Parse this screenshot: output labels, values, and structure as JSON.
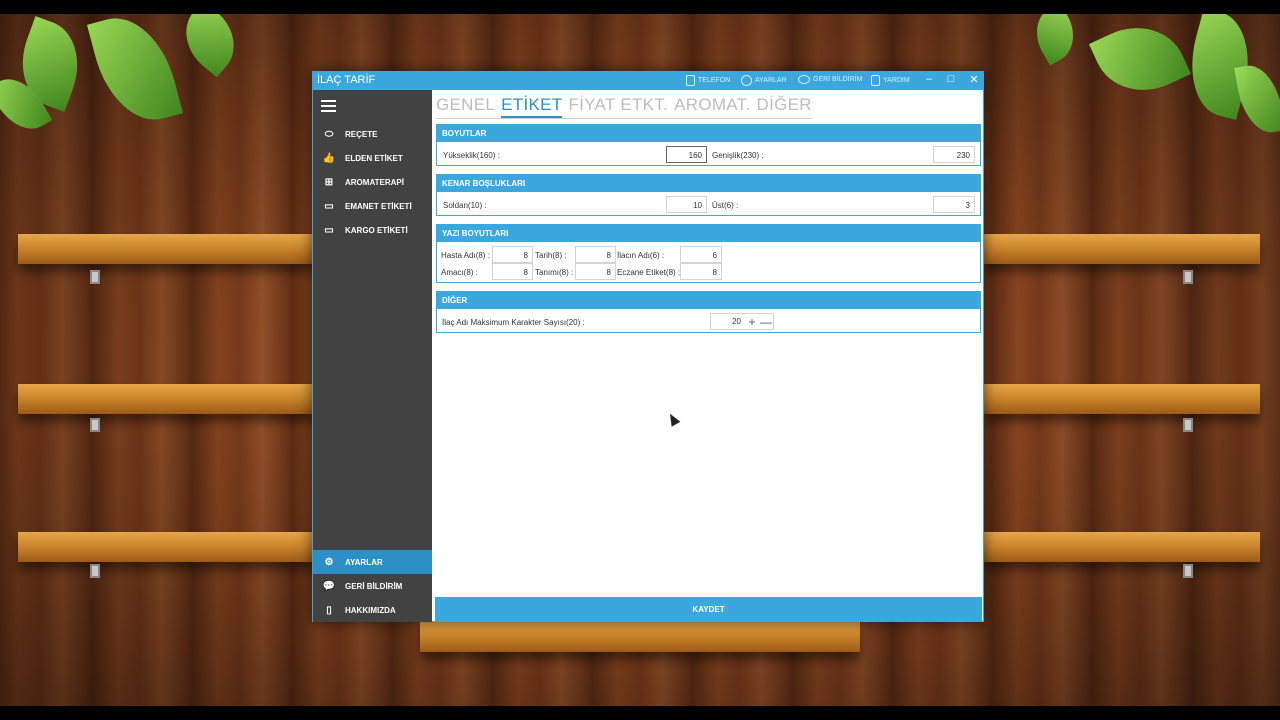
{
  "window": {
    "title": "İLAÇ TARİF",
    "titlebar_items": [
      {
        "label": "TELEFON",
        "icon": "phone-icon"
      },
      {
        "label": "AYARLAR",
        "icon": "gear-icon"
      },
      {
        "label": "GERİ BİLDİRİM",
        "icon": "chat-icon"
      },
      {
        "label": "YARDIM",
        "icon": "help-icon"
      }
    ],
    "controls": {
      "minimize": "–",
      "maximize": "□",
      "close": "✕"
    }
  },
  "sidebar": {
    "items": [
      {
        "label": "REÇETE",
        "icon": "pill-icon"
      },
      {
        "label": "ELDEN ETİKET",
        "icon": "thumb-icon"
      },
      {
        "label": "AROMATERAPİ",
        "icon": "add-box-icon"
      },
      {
        "label": "EMANET ETİKETİ",
        "icon": "window-icon"
      },
      {
        "label": "KARGO ETİKETİ",
        "icon": "window-icon"
      }
    ],
    "bottom_items": [
      {
        "label": "AYARLAR",
        "icon": "gear-icon",
        "active": true
      },
      {
        "label": "GERİ BİLDİRİM",
        "icon": "chat-icon"
      },
      {
        "label": "HAKKIMIZDA",
        "icon": "phone-icon"
      }
    ]
  },
  "tabs": [
    "GENEL",
    "ETİKET",
    "FİYAT ETKT.",
    "AROMAT.",
    "DİĞER"
  ],
  "active_tab": "ETİKET",
  "groups": {
    "boyutlar": {
      "title": "BOYUTLAR",
      "height_label": "Yükseklik(160) :",
      "height_value": "160",
      "width_label": "Genişlik(230) :",
      "width_value": "230"
    },
    "kenar": {
      "title": "KENAR BOŞLUKLARI",
      "left_label": "Soldan(10) :",
      "left_value": "10",
      "top_label": "Üst(6) :",
      "top_value": "3"
    },
    "yazi": {
      "title": "YAZI BOYUTLARI",
      "hasta_label": "Hasta Adı(8) :",
      "hasta_value": "8",
      "tarih_label": "Tarih(8) :",
      "tarih_value": "8",
      "ilac_label": "İlacın Adı(6) :",
      "ilac_value": "6",
      "amac_label": "Amacı(8) :",
      "amac_value": "8",
      "tanim_label": "Tanımı(8) :",
      "tanim_value": "8",
      "eczane_label": "Eczane Etiket(8) :",
      "eczane_value": "8"
    },
    "diger": {
      "title": "DİĞER",
      "maxchar_label": "İlaç Adı Maksimum Karakter Sayısı(20) :",
      "maxchar_value": "20",
      "plus": "+",
      "minus": "—"
    }
  },
  "save_label": "KAYDET"
}
